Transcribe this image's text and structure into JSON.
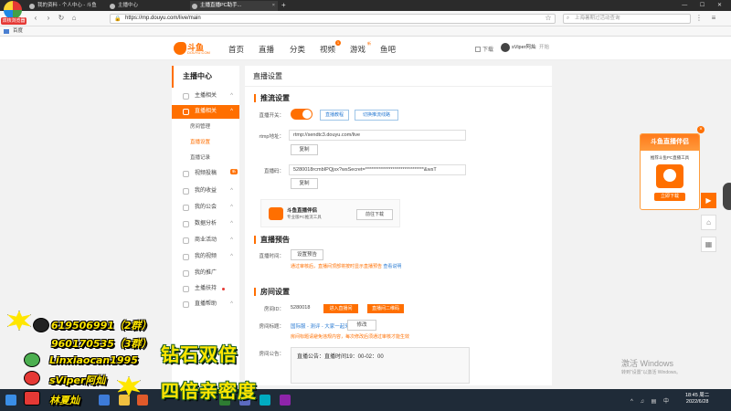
{
  "browser": {
    "logo_label": "双核浏览器",
    "tabs": [
      {
        "label": "我的资料 - 个人中心 - 斗鱼",
        "active": false
      },
      {
        "label": "主播中心",
        "active": false
      },
      {
        "label": "主播直播PC助手...",
        "active": true
      }
    ],
    "url": "https://mp.douyu.com/live/main",
    "search_placeholder": "上海暑期过活动查询",
    "bookmark": "百度"
  },
  "site": {
    "logo_text": "斗鱼",
    "logo_sub": "DOUYU.COM",
    "nav": [
      "首页",
      "直播",
      "分类",
      "视频",
      "游戏",
      "鱼吧"
    ],
    "video_badge": "1",
    "yuba_tag": "新",
    "download": "下载",
    "username": "sViper阿灿",
    "user_level": "开始"
  },
  "sidebar": {
    "title": "主播中心",
    "items": [
      {
        "label": "主播相关",
        "arrow": "^"
      },
      {
        "label": "直播相关",
        "arrow": "^",
        "active": true
      },
      {
        "label": "房间管理",
        "sub": true
      },
      {
        "label": "直播设置",
        "sub": true,
        "current": true
      },
      {
        "label": "直播记录",
        "sub": true
      },
      {
        "label": "视频投稿",
        "arrow": "",
        "badge": "新"
      },
      {
        "label": "我的收益",
        "arrow": "^"
      },
      {
        "label": "我的公会",
        "arrow": "^"
      },
      {
        "label": "数据分析",
        "arrow": "^"
      },
      {
        "label": "商业活动",
        "arrow": "^"
      },
      {
        "label": "我的视频",
        "arrow": "^"
      },
      {
        "label": "我的推广",
        "arrow": ""
      },
      {
        "label": "主播扶持",
        "arrow": "",
        "dot": true
      },
      {
        "label": "直播帮助",
        "arrow": "^"
      }
    ]
  },
  "main": {
    "title": "直播设置",
    "stream": {
      "heading": "推流设置",
      "switch_label": "直播开关：",
      "btn_tutorial": "直播教程",
      "btn_other": "切换推流线路",
      "rtmp_label": "rtmp地址：",
      "rtmp_value": "rtmp://sendtc3.douyu.com/live",
      "copy": "复制",
      "code_label": "直播码：",
      "code_value": "5280018rcmbIPQjsx?wsSecret=******************************&wsT",
      "promo_title": "斗鱼直播伴侣",
      "promo_sub": "专业版PC推流工具",
      "promo_btn": "前往下载"
    },
    "preview": {
      "heading": "直播预告",
      "label": "直播时间：",
      "btn": "设置预告",
      "note": "通过审核后，直播间顶部将按时显示直播预告",
      "note_link": "查看说明"
    },
    "room": {
      "heading": "房间设置",
      "id_label": "房间ID：",
      "id_value": "5280018",
      "btn_enter": "进入直播间",
      "btn_share": "直播间二维码",
      "title_label": "房间标题：",
      "title_value": "国际服 - 测评 - 大家一起来",
      "title_btn": "修改",
      "title_note": "房间标题请避免违规内容，每次修改后须通过审核才能生效",
      "notice_label": "房间公告：",
      "notice_value": "直播公告：直播时间19：00-02：00"
    }
  },
  "ad": {
    "header": "斗鱼直播伴侣",
    "desc": "推荐斗鱼PC直播工具",
    "btn": "立即下载"
  },
  "watermark": {
    "line1": "激活 Windows",
    "line2": "转到“设置”以激活 Windows。"
  },
  "taskbar": {
    "time": "18:45 周二",
    "date": "2022/6/28"
  },
  "overlay": {
    "qq1": "619506991（2群）",
    "qq2": "960170535（3群）",
    "wechat": "Linxiaocan1995",
    "weibo": "sViper阿灿",
    "douyin": "林夏灿",
    "big1": "钻石双倍",
    "big2": "四倍亲密度",
    "colors": {
      "overlay_text": "#ffe600",
      "accent": "#ff6f00"
    }
  }
}
